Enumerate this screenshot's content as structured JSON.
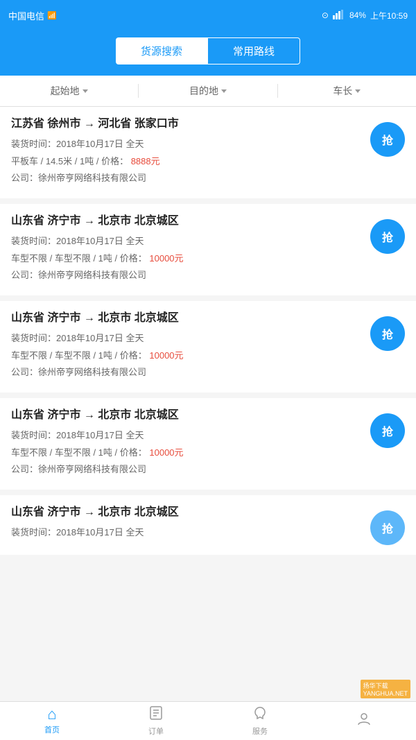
{
  "statusBar": {
    "carrier": "中国电信",
    "time": "上午10:59",
    "battery": "84"
  },
  "header": {
    "tab1": "货源搜索",
    "tab2": "常用路线",
    "activeTab": "tab1"
  },
  "filter": {
    "origin": "起始地",
    "destination": "目的地",
    "carLength": "车长"
  },
  "cards": [
    {
      "title": "江苏省 徐州市 → 河北省 张家口市",
      "loadingTime": "装货时间：2018年10月17日 全天",
      "carInfo": "平板车 / 14.5米 / 1吨 /",
      "priceLabel": "价格：",
      "price": "8888元",
      "company": "公司：徐州帝亨网络科技有限公司",
      "btnLabel": "抢"
    },
    {
      "title": "山东省 济宁市 → 北京市 北京城区",
      "loadingTime": "装货时间：2018年10月17日 全天",
      "carInfo": "车型不限 / 车型不限 / 1吨 /",
      "priceLabel": "价格：",
      "price": "10000元",
      "company": "公司：徐州帝亨网络科技有限公司",
      "btnLabel": "抢"
    },
    {
      "title": "山东省 济宁市 → 北京市 北京城区",
      "loadingTime": "装货时间：2018年10月17日 全天",
      "carInfo": "车型不限 / 车型不限 / 1吨 /",
      "priceLabel": "价格：",
      "price": "10000元",
      "company": "公司：徐州帝亨网络科技有限公司",
      "btnLabel": "抢"
    },
    {
      "title": "山东省 济宁市 → 北京市 北京城区",
      "loadingTime": "装货时间：2018年10月17日 全天",
      "carInfo": "车型不限 / 车型不限 / 1吨 /",
      "priceLabel": "价格：",
      "price": "10000元",
      "company": "公司：徐州帝亨网络科技有限公司",
      "btnLabel": "抢"
    }
  ],
  "partialCard": {
    "title": "山东省 济宁市 → 北京市 北京城区",
    "loadingTime": "装货时间：2018年10月17日 全天",
    "btnLabel": "抢"
  },
  "bottomNav": [
    {
      "icon": "⌂",
      "label": "首页",
      "active": true
    },
    {
      "icon": "☰",
      "label": "订单",
      "active": false
    },
    {
      "icon": "♡",
      "label": "服务",
      "active": false
    },
    {
      "icon": "👤",
      "label": "",
      "active": false
    }
  ],
  "watermark": "扬华下载\nYANGHUA.NET"
}
